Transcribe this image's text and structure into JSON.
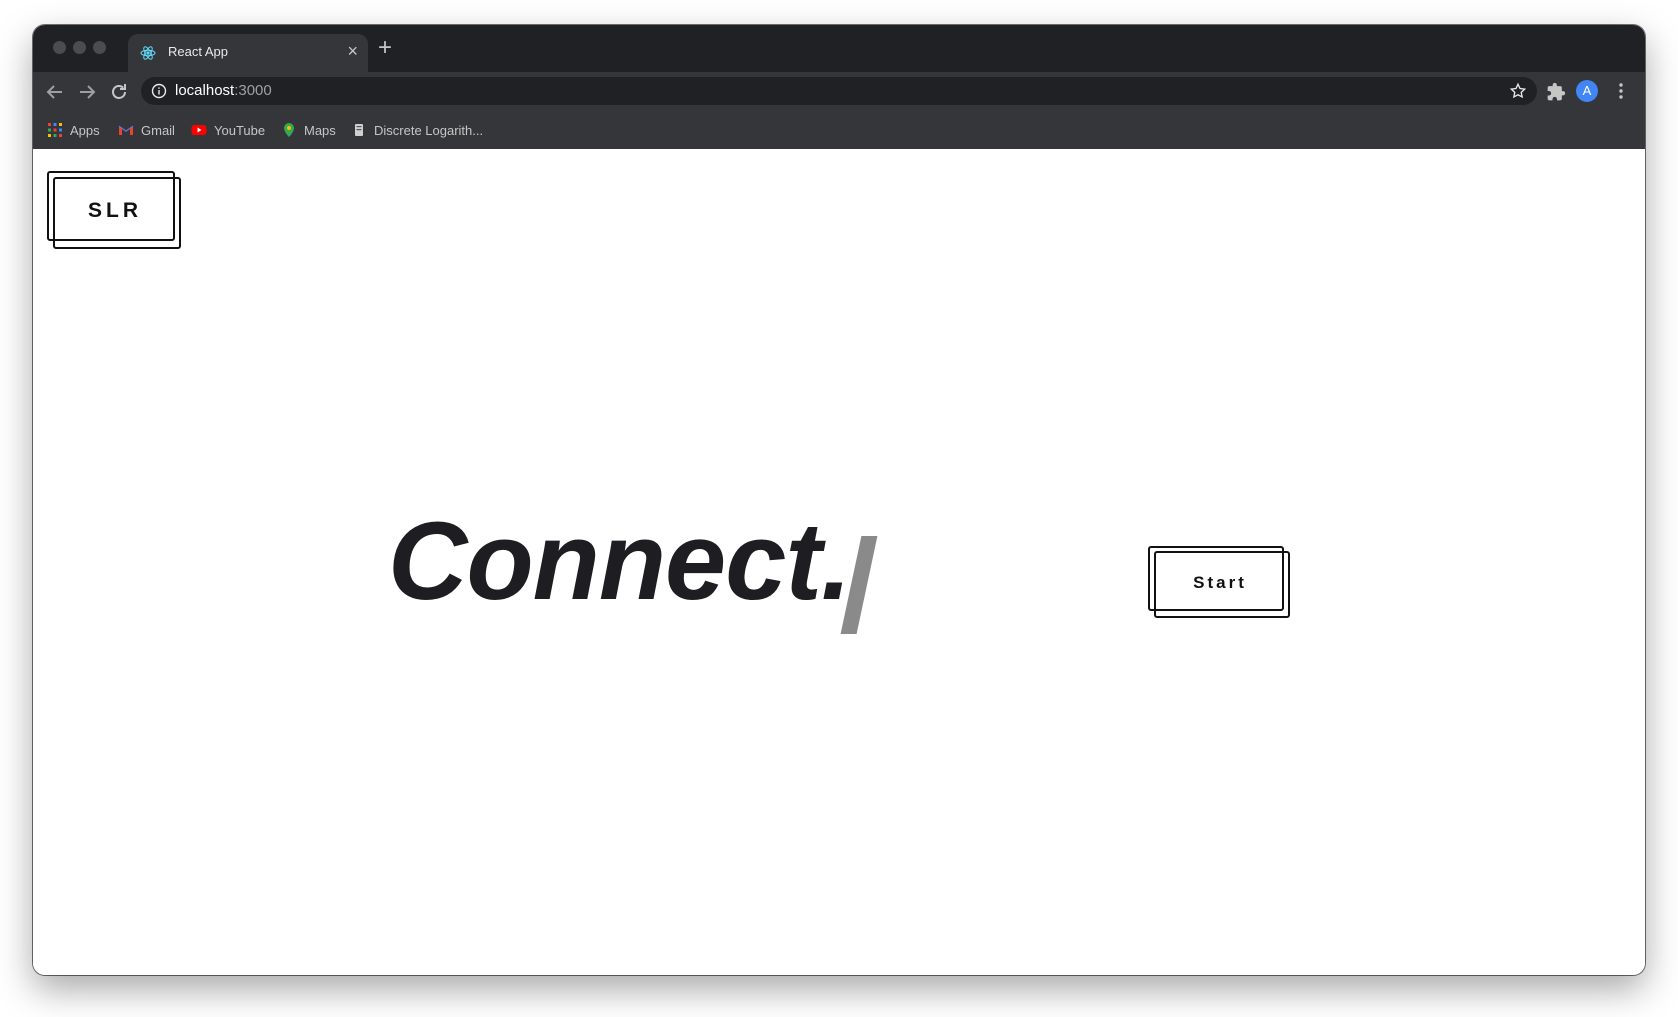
{
  "browser": {
    "tab_title": "React App",
    "url_host": "localhost",
    "url_port": ":3000",
    "profile_initial": "A",
    "bookmarks": [
      {
        "label": "Apps",
        "icon": "apps-grid-icon"
      },
      {
        "label": "Gmail",
        "icon": "gmail-icon"
      },
      {
        "label": "YouTube",
        "icon": "youtube-icon"
      },
      {
        "label": "Maps",
        "icon": "maps-icon"
      },
      {
        "label": "Discrete Logarith...",
        "icon": "page-favicon-icon"
      }
    ]
  },
  "page": {
    "logo_label": "SLR",
    "hero_text": "Connect.",
    "start_label": "Start"
  },
  "colors": {
    "frame_dark": "#202124",
    "toolbar": "#35363a",
    "text_dark": "#1d1d22",
    "cursor_gray": "#8a8a8a",
    "avatar_blue": "#4285f4"
  }
}
